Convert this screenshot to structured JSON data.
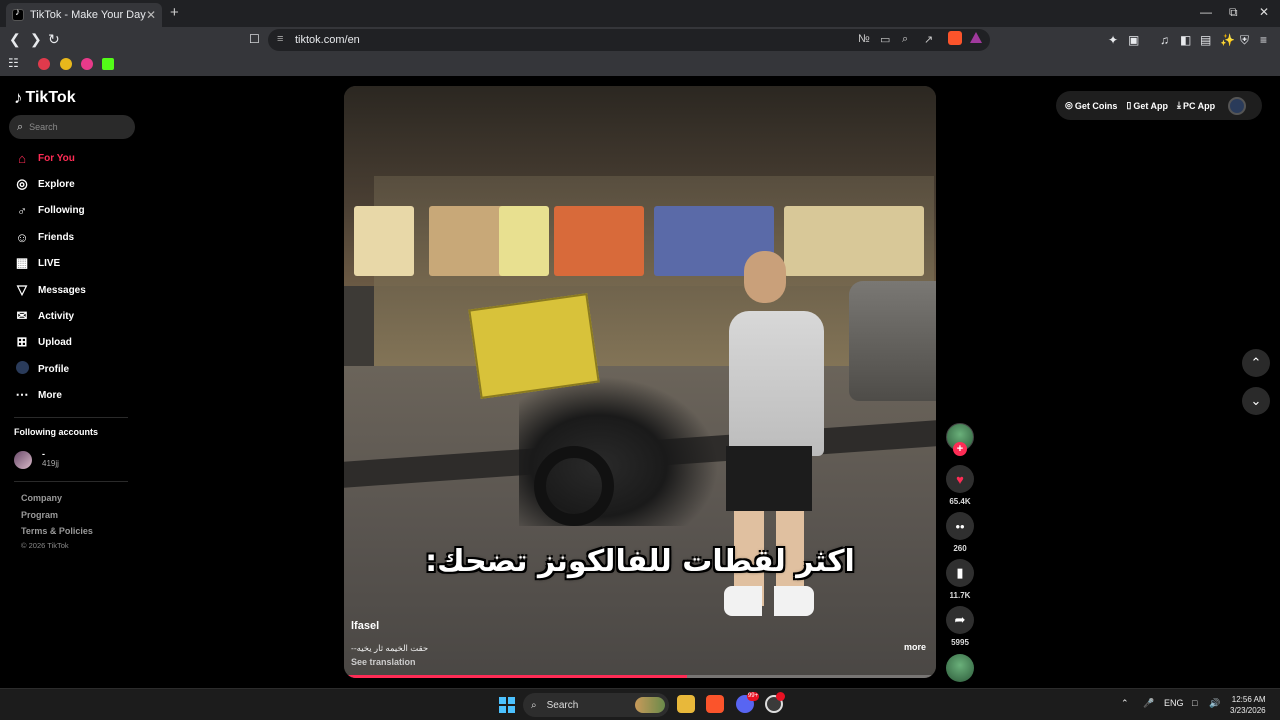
{
  "browser": {
    "tab_title": "TikTok - Make Your Day",
    "tab_close": "✕",
    "new_tab": "+",
    "url": "tiktok.com/en",
    "window_controls": {
      "minimize": "—",
      "restore": "⧉",
      "close": "✕"
    }
  },
  "sidebar": {
    "logo": "TikTok",
    "search_placeholder": "Search",
    "menu": [
      {
        "label": "For You",
        "icon": "home-icon",
        "active": true
      },
      {
        "label": "Explore",
        "icon": "compass-icon"
      },
      {
        "label": "Following",
        "icon": "user-plus-icon"
      },
      {
        "label": "Friends",
        "icon": "users-icon"
      },
      {
        "label": "LIVE",
        "icon": "live-tv-icon"
      },
      {
        "label": "Messages",
        "icon": "send-icon"
      },
      {
        "label": "Activity",
        "icon": "inbox-icon"
      },
      {
        "label": "Upload",
        "icon": "plus-square-icon"
      },
      {
        "label": "Profile",
        "icon": "avatar-icon"
      },
      {
        "label": "More",
        "icon": "ellipsis-icon"
      }
    ],
    "following_accounts_title": "Following accounts",
    "following_account": {
      "name": "-",
      "handle": "419jj"
    },
    "footer_links": [
      "Company",
      "Program",
      "Terms & Policies"
    ],
    "copyright": "© 2026 TikTok"
  },
  "video": {
    "caption_overlay": "اكثر لقطات للفالكونز تضحك:",
    "username": "lfasel",
    "description": "--حقت الخيمه ثار يخيه",
    "see_translation": "See translation",
    "more": "more",
    "progress": 0.58
  },
  "actions": {
    "likes": "65.4K",
    "comments": "260",
    "saves": "11.7K",
    "shares": "5995"
  },
  "topright": {
    "get_coins": "Get Coins",
    "get_app": "Get App",
    "pc_app": "PC App"
  },
  "taskbar": {
    "search": "Search",
    "language": "ENG",
    "time": "12:56 AM",
    "date": "3/23/2026",
    "discord_badge": "99+"
  },
  "colors": {
    "accent": "#fe2c55",
    "background": "#000000"
  }
}
